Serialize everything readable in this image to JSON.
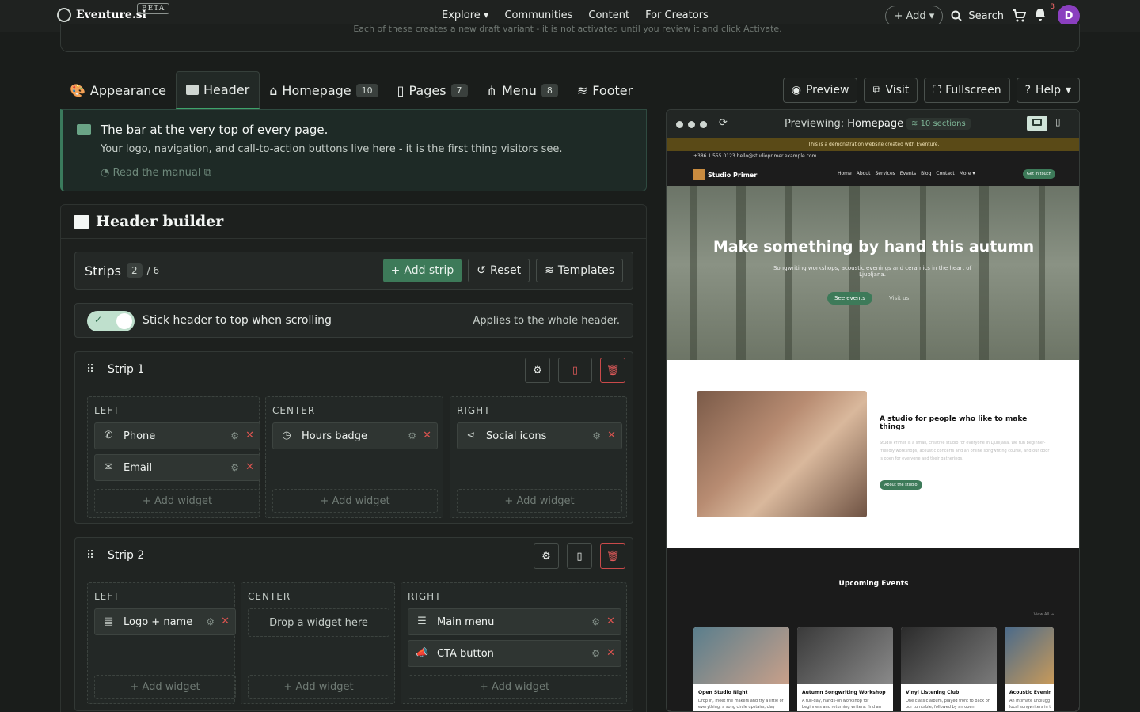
{
  "nav": {
    "brand": "Eventure.si",
    "beta": "BETA",
    "links": [
      "Explore ▾",
      "Communities",
      "Content",
      "For Creators"
    ],
    "add": "+ Add ▾",
    "search": "Search",
    "notif_count": "8",
    "avatar": "D"
  },
  "draft_notice": "Each of these creates a new draft variant - it is not activated until you review it and click Activate.",
  "tabs": [
    {
      "label": "Appearance",
      "count": ""
    },
    {
      "label": "Header",
      "count": ""
    },
    {
      "label": "Homepage",
      "count": "10"
    },
    {
      "label": "Pages",
      "count": "7"
    },
    {
      "label": "Menu",
      "count": "8"
    },
    {
      "label": "Footer",
      "count": ""
    }
  ],
  "tab_actions": {
    "preview": "Preview",
    "visit": "Visit",
    "fullscreen": "Fullscreen",
    "help": "Help"
  },
  "info": {
    "title": "The bar at the very top of every page.",
    "body": "Your logo, navigation, and call-to-action buttons live here - it is the first thing visitors see.",
    "manual": "Read the manual"
  },
  "builder": {
    "title": "Header builder",
    "strips_label": "Strips",
    "strips_count": "2",
    "strips_max": "/ 6",
    "add_strip": "Add strip",
    "reset": "Reset",
    "templates": "Templates",
    "sticky_label": "Stick header to top when scrolling",
    "sticky_note": "Applies to the whole header.",
    "add_widget": "Add widget",
    "drop_here": "Drop a widget here",
    "strip1": {
      "name": "Strip 1",
      "left_label": "LEFT",
      "center_label": "CENTER",
      "right_label": "RIGHT",
      "left": [
        "Phone",
        "Email"
      ],
      "center": [
        "Hours badge"
      ],
      "right": [
        "Social icons"
      ]
    },
    "strip2": {
      "name": "Strip 2",
      "left_label": "LEFT",
      "center_label": "CENTER",
      "right_label": "RIGHT",
      "left": [
        "Logo + name"
      ],
      "right": [
        "Main menu",
        "CTA button"
      ]
    }
  },
  "preview": {
    "previewing": "Previewing:",
    "page": "Homepage",
    "sections": "10 sections",
    "site": {
      "demo": "This is a demonstration website created with Eventure.",
      "contact": "+386 1 555 0123   hello@studioprimer.example.com",
      "brand": "Studio Primer",
      "links": [
        "Home",
        "About",
        "Services",
        "Events",
        "Blog",
        "Contact",
        "More ▾"
      ],
      "get_in_touch": "Get in touch",
      "hero_title": "Make something by hand this autumn",
      "hero_sub": "Songwriting workshops, acoustic evenings and ceramics in the heart of Ljubljana.",
      "hero_cta": "See events",
      "hero_cta2": "Visit us",
      "about_title": "A studio for people who like to make things",
      "about_body": "Studio Primer is a small, creative studio for everyone in Ljubljana. We run beginner-friendly workshops, acoustic concerts and an online songwriting course, and our door is open for everyone and their gatherings.",
      "about_btn": "About the studio",
      "events_title": "Upcoming Events",
      "view_all": "View All →",
      "events": [
        {
          "title": "Open Studio Night",
          "desc": "Drop in, meet the makers and try a little of everything: a song circle upstairs, clay"
        },
        {
          "title": "Autumn Songwriting Workshop",
          "desc": "A full-day, hands-on workshop for beginners and returning writers: find an"
        },
        {
          "title": "Vinyl Listening Club",
          "desc": "One classic album, played front to back on our turntable, followed by an open"
        },
        {
          "title": "Acoustic Evenin",
          "desc": "An intimate unplugg local songwriters in t"
        }
      ]
    }
  }
}
